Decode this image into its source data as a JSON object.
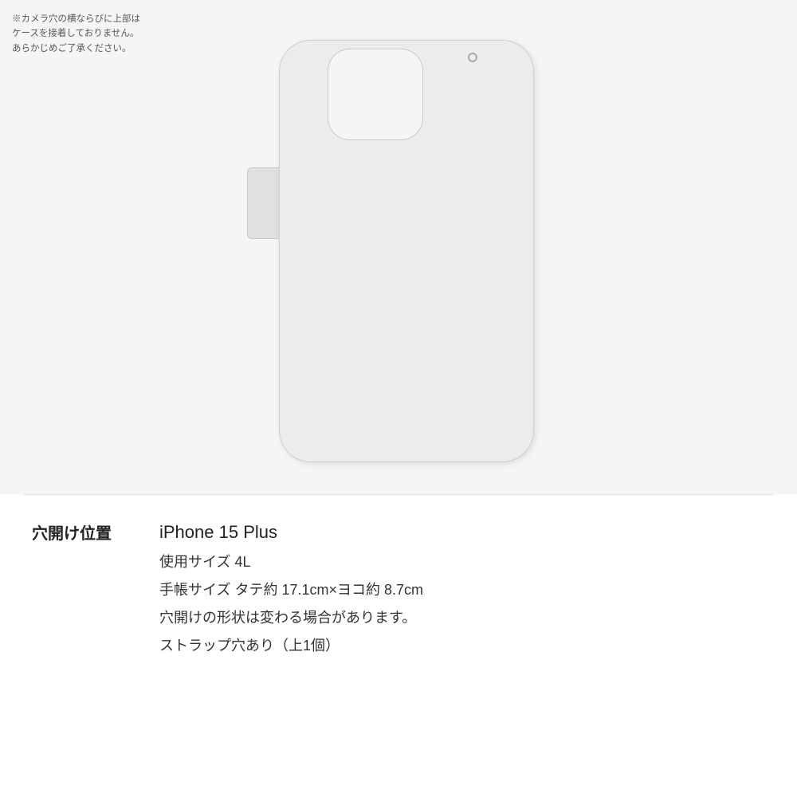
{
  "camera_note": {
    "line1": "※カメラ穴の横ならびに上部は",
    "line2": "ケースを接着しておりません。",
    "line3": "あらかじめご了承ください。"
  },
  "hole_label": "穴開け位置",
  "product": {
    "model": "iPhone 15 Plus",
    "size_label": "使用サイズ 4L",
    "dimensions": "手帳サイズ タテ約 17.1cm×ヨコ約 8.7cm",
    "shape_note": "穴開けの形状は変わる場合があります。",
    "strap_note": "ストラップ穴あり（上1個）"
  }
}
